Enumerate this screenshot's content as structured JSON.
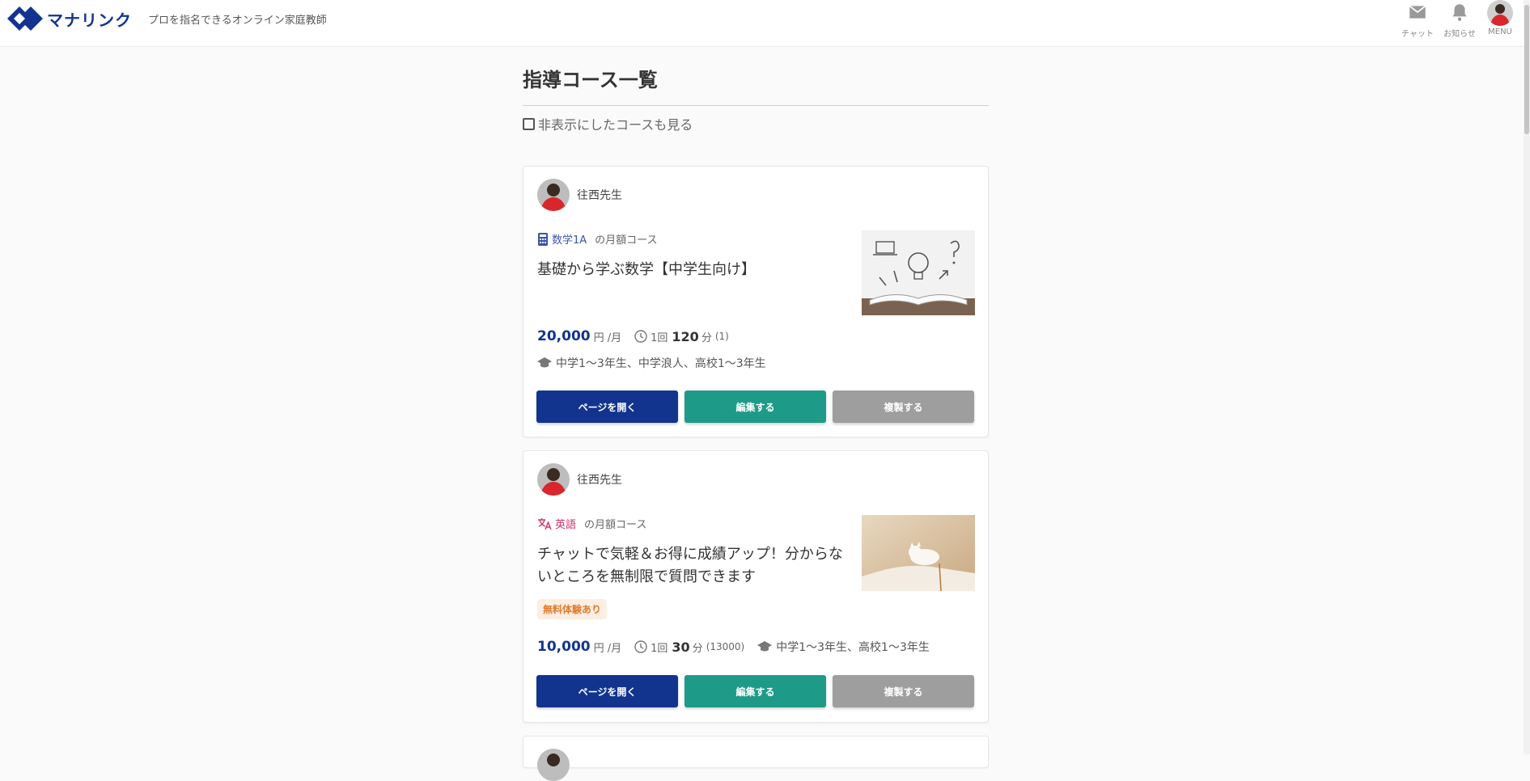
{
  "header": {
    "logo_text": "マナリンク",
    "tagline": "プロを指名できるオンライン家庭教師",
    "chat_label": "チャット",
    "news_label": "お知らせ",
    "menu_label": "MENU"
  },
  "page": {
    "title": "指導コース一覧",
    "show_hidden_label": "非表示にしたコースも見る"
  },
  "courses": [
    {
      "teacher": "往西先生",
      "subject": "数学1A",
      "subject_color": "#3a56a8",
      "subject_icon": "calculator-icon",
      "plan": "の月額コース",
      "title": "基礎から学ぶ数学【中学生向け】",
      "price": "20,000",
      "price_unit": "円 /月",
      "per_label": "1回",
      "minutes": "120",
      "minutes_unit": "分",
      "count": "(1)",
      "grades": "中学1～3年生、中学浪人、高校1～3年生",
      "open_label": "ページを開く",
      "edit_label": "編集する",
      "copy_label": "複製する"
    },
    {
      "teacher": "往西先生",
      "subject": "英語",
      "subject_color": "#d0306b",
      "subject_icon": "translate-icon",
      "plan": "の月額コース",
      "title": "チャットで気軽＆お得に成績アップ！分からないところを無制限で質問できます",
      "badge": "無料体験あり",
      "price": "10,000",
      "price_unit": "円 /月",
      "per_label": "1回",
      "minutes": "30",
      "minutes_unit": "分",
      "count": "(13000)",
      "grades": "中学1～3年生、高校1～3年生",
      "open_label": "ページを開く",
      "edit_label": "編集する",
      "copy_label": "複製する"
    }
  ],
  "colors": {
    "brand": "#12348f",
    "teal": "#1e9a89",
    "gray_button": "#9e9e9e",
    "badge_bg": "#fdeee2",
    "badge_text": "#e07a2e"
  }
}
